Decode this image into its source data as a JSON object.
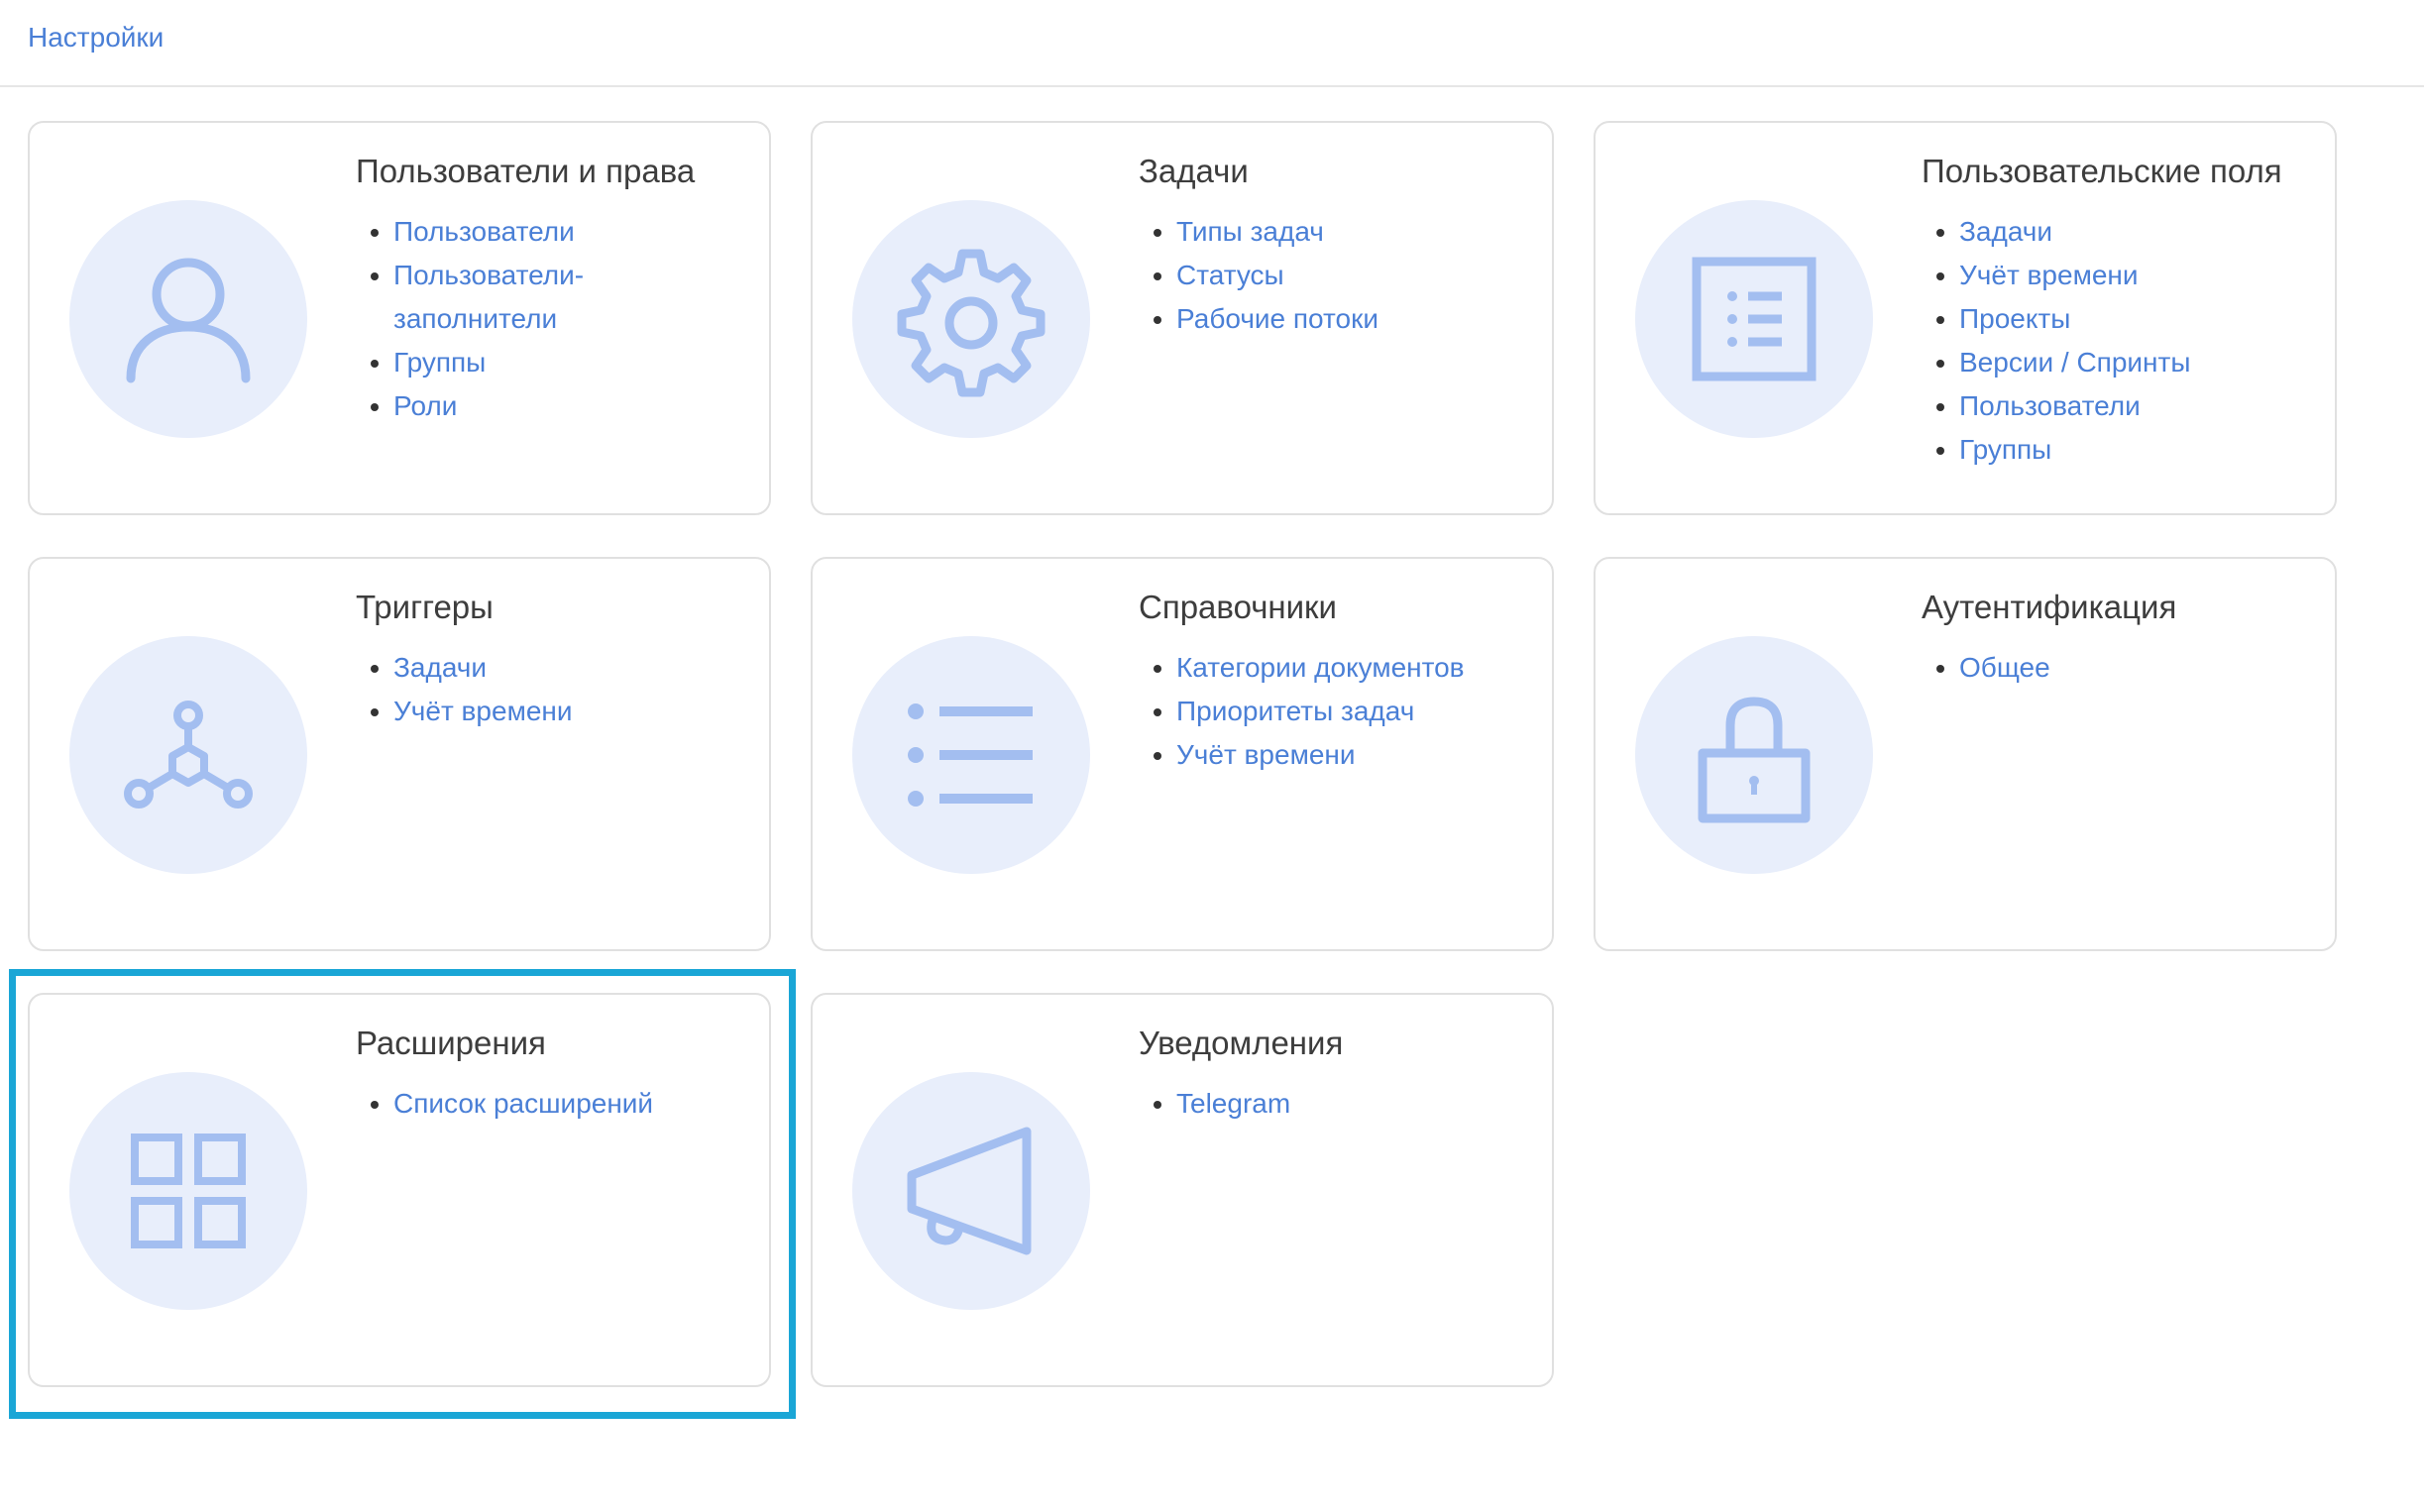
{
  "breadcrumb": {
    "label": "Настройки"
  },
  "colors": {
    "link": "#4a7fd6",
    "icon_bg": "#e8eefb",
    "icon_stroke": "#a3bef0",
    "highlight": "#1aa6d6"
  },
  "cards": [
    {
      "title": "Пользователи и права",
      "icon": "user-icon",
      "links": [
        "Пользователи",
        "Пользователи-заполнители",
        "Группы",
        "Роли"
      ]
    },
    {
      "title": "Задачи",
      "icon": "gear-icon",
      "links": [
        "Типы задач",
        "Статусы",
        "Рабочие потоки"
      ]
    },
    {
      "title": "Пользовательские поля",
      "icon": "form-list-icon",
      "links": [
        "Задачи",
        "Учёт времени",
        "Проекты",
        "Версии / Спринты",
        "Пользователи",
        "Группы"
      ]
    },
    {
      "title": "Триггеры",
      "icon": "trigger-network-icon",
      "links": [
        "Задачи",
        "Учёт времени"
      ]
    },
    {
      "title": "Справочники",
      "icon": "list-icon",
      "links": [
        "Категории документов",
        "Приоритеты задач",
        "Учёт времени"
      ]
    },
    {
      "title": "Аутентификация",
      "icon": "lock-icon",
      "links": [
        "Общее"
      ]
    },
    {
      "title": "Расширения",
      "icon": "grid-icon",
      "links": [
        "Список расширений"
      ]
    },
    {
      "title": "Уведомления",
      "icon": "megaphone-icon",
      "links": [
        "Telegram"
      ]
    }
  ]
}
